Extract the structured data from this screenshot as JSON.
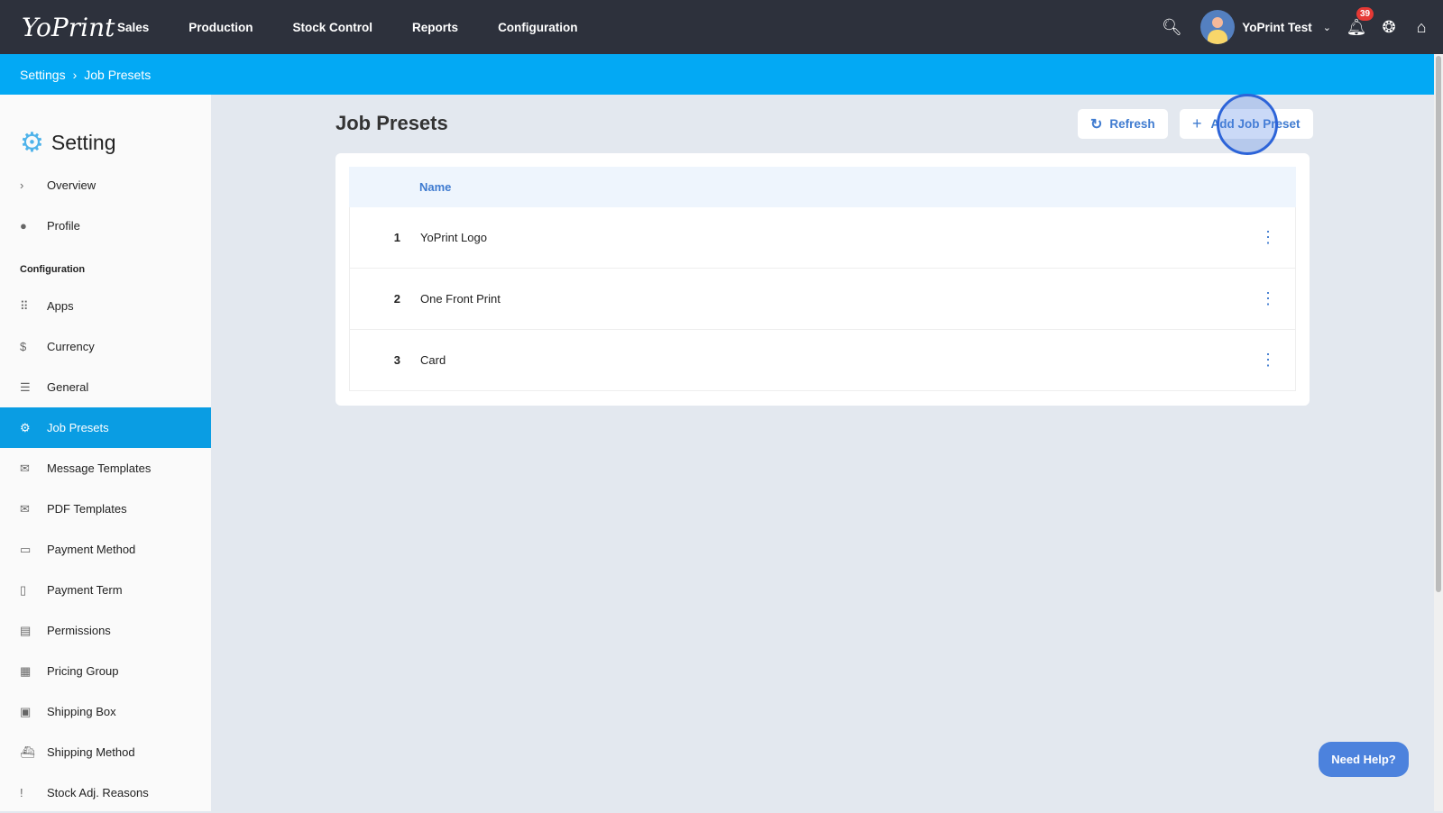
{
  "header": {
    "logo": "YoPrint",
    "nav": [
      "Sales",
      "Production",
      "Stock Control",
      "Reports",
      "Configuration"
    ],
    "user": "YoPrint Test",
    "notifications": "39"
  },
  "breadcrumb": [
    "Settings",
    "Job Presets"
  ],
  "sidebar": {
    "title": "Setting",
    "top": [
      {
        "icon": "›",
        "label": "Overview"
      },
      {
        "icon": "●",
        "label": "Profile"
      }
    ],
    "section": "Configuration",
    "items": [
      {
        "icon": "⠿",
        "label": "Apps"
      },
      {
        "icon": "$",
        "label": "Currency"
      },
      {
        "icon": "☰",
        "label": "General"
      },
      {
        "icon": "⚙",
        "label": "Job Presets"
      },
      {
        "icon": "✉",
        "label": "Message Templates"
      },
      {
        "icon": "✉",
        "label": "PDF Templates"
      },
      {
        "icon": "▭",
        "label": "Payment Method"
      },
      {
        "icon": "▯",
        "label": "Payment Term"
      },
      {
        "icon": "▤",
        "label": "Permissions"
      },
      {
        "icon": "▦",
        "label": "Pricing Group"
      },
      {
        "icon": "▣",
        "label": "Shipping Box"
      },
      {
        "icon": "⛴",
        "label": "Shipping Method"
      },
      {
        "icon": "!",
        "label": "Stock Adj. Reasons"
      }
    ]
  },
  "main": {
    "title": "Job Presets",
    "refresh": "Refresh",
    "add": "Add Job Preset",
    "column": "Name",
    "rows": [
      {
        "n": "1",
        "name": "YoPrint Logo"
      },
      {
        "n": "2",
        "name": "One Front Print"
      },
      {
        "n": "3",
        "name": "Card"
      }
    ]
  },
  "help": "Need Help?"
}
